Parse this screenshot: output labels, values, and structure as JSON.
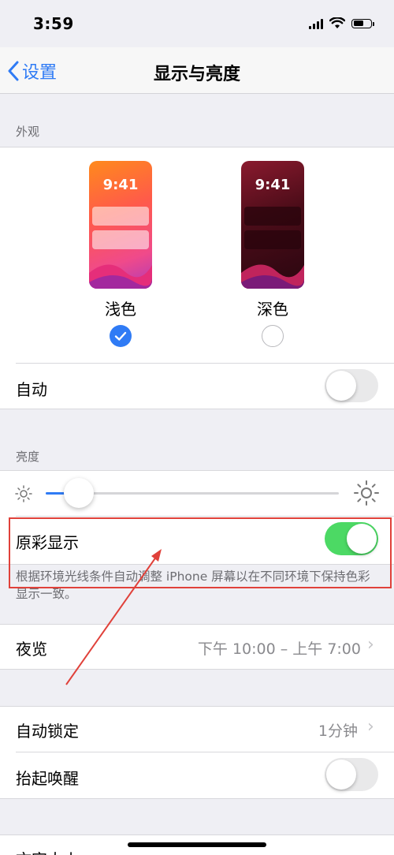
{
  "status": {
    "time": "3:59"
  },
  "nav": {
    "back_label": "设置",
    "title": "显示与亮度"
  },
  "appearance": {
    "section_label": "外观",
    "light": {
      "preview_time": "9:41",
      "label": "浅色",
      "selected": true
    },
    "dark": {
      "preview_time": "9:41",
      "label": "深色",
      "selected": false
    },
    "auto": {
      "label": "自动",
      "on": false
    }
  },
  "brightness": {
    "section_label": "亮度",
    "level": 0.08,
    "true_tone": {
      "label": "原彩显示",
      "on": true
    },
    "true_tone_footer": "根据环境光线条件自动调整 iPhone 屏幕以在不同环境下保持色彩显示一致。"
  },
  "night_shift": {
    "label": "夜览",
    "value": "下午 10:00 – 上午 7:00"
  },
  "auto_lock": {
    "label": "自动锁定",
    "value": "1分钟"
  },
  "raise_to_wake": {
    "label": "抬起唤醒",
    "on": false
  },
  "text_size": {
    "label": "文字大小"
  },
  "colors": {
    "accent": "#2f7bf5",
    "toggle_on": "#4cd964",
    "annotation": "#e0413a"
  }
}
